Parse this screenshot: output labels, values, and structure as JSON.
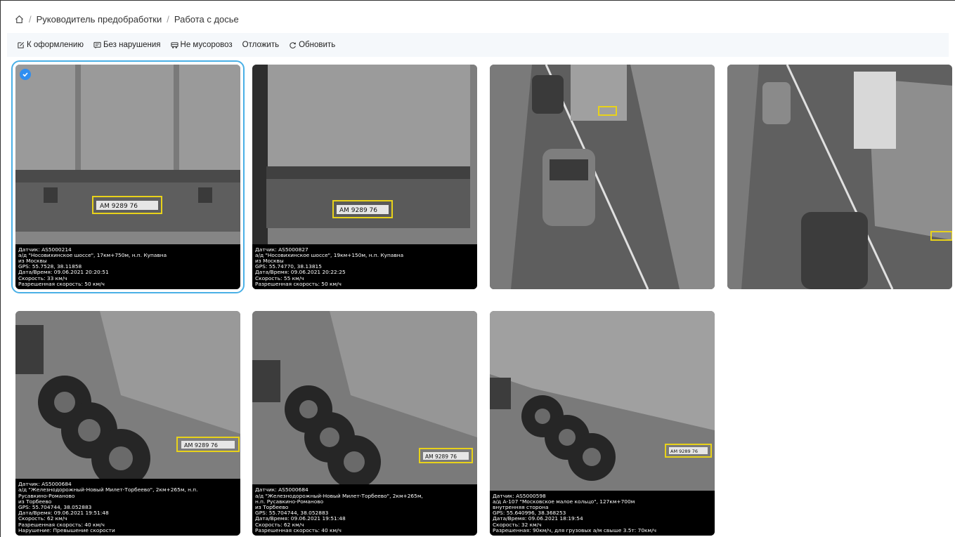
{
  "breadcrumb": {
    "home_icon": "home-icon",
    "items": [
      "Руководитель предобработки",
      "Работа с досье"
    ]
  },
  "toolbar": {
    "buttons": [
      {
        "label": "К оформлению",
        "icon": "edit-icon"
      },
      {
        "label": "Без нарушения",
        "icon": "message-icon"
      },
      {
        "label": "Не мусоровоз",
        "icon": "truck-icon"
      },
      {
        "label": "Отложить",
        "icon": ""
      },
      {
        "label": "Обновить",
        "icon": "refresh-icon"
      }
    ]
  },
  "colors": {
    "accent": "#4ab0e6",
    "check": "#2f8ef0",
    "plate_box": "#e8d21a",
    "toolbar_bg": "#f5f8fb"
  },
  "cards": [
    {
      "selected": true,
      "plate": "АМ 9289 76",
      "caption": [
        "Датчик: AS5000214",
        "а/д \"Носовихинское шоссе\", 17км+750м, н.п. Купавна",
        "из Москвы",
        "GPS: 55.7528, 38.11858",
        "Дата/Время: 09.06.2021 20:20:51",
        "Скорость: 33 км/ч",
        "Разрешенная скорость: 50 км/ч"
      ]
    },
    {
      "selected": false,
      "plate": "АМ 9289 76",
      "caption": [
        "Датчик: AS5000827",
        "а/д \"Носовихинское шоссе\", 19км+150м, н.п. Купавна",
        "из Москвы",
        "GPS: 55.74770, 38.13815",
        "Дата/Время: 09.06.2021 20:22:25",
        "Скорость: 55 км/ч",
        "Разрешенная скорость: 50 км/ч"
      ]
    },
    {
      "selected": false,
      "plate": "",
      "caption": []
    },
    {
      "selected": false,
      "plate": "",
      "caption": []
    },
    {
      "selected": false,
      "plate": "АМ 9289 76",
      "caption": [
        "Датчик: AS5000684",
        "а/д \"Железнодорожный-Новый Милет-Торбеево\", 2км+265м, н.п.",
        "Русавкино-Романово",
        "из Торбеево",
        "GPS: 55.704744, 38.052883",
        "Дата/Время: 09.06.2021 19:51:48",
        "Скорость: 62 км/ч",
        "Разрешенная скорость: 40 км/ч",
        "Нарушение: Превышение скорости"
      ]
    },
    {
      "selected": false,
      "plate": "АМ 9289 76",
      "caption": [
        "Датчик: AS5000684",
        "а/д \"Железнодорожный-Новый Милет-Торбеево\", 2км+265м,",
        "н.п. Русавкино-Романово",
        "из Торбеево",
        "GPS: 55.704744, 38.052883",
        "Дата/Время: 09.06.2021 19:51:48",
        "Скорость: 62 км/ч",
        "Разрешенная скорость: 40 км/ч"
      ]
    },
    {
      "selected": false,
      "plate": "АМ 9289 76",
      "caption": [
        "Датчик: AS5000598",
        "а/д А-107 \"Московское малое кольцо\", 127км+700м",
        "внутренняя сторона",
        "GPS: 55.640996, 38.368253",
        "Дата/Время: 09.06.2021 18:19:54",
        "Скорость: 32 км/ч",
        "Разрешенная: 90км/ч, для грузовых а/м свыше 3.5т: 70км/ч"
      ]
    }
  ]
}
